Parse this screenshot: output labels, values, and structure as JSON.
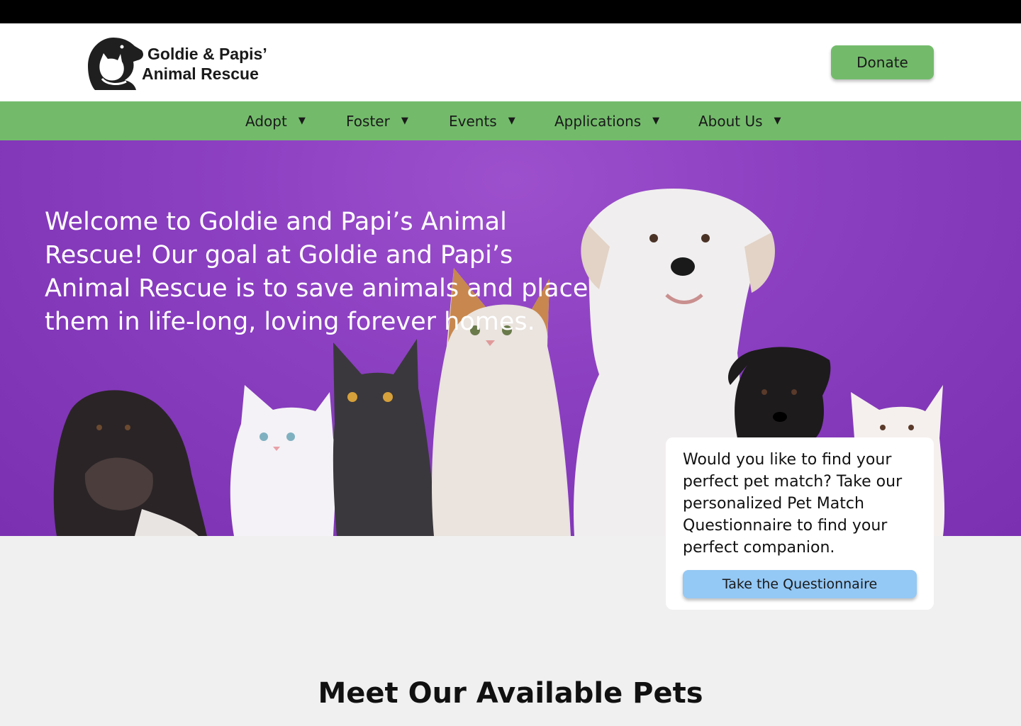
{
  "header": {
    "logo_line1": "Goldie & Papis’",
    "logo_line2": "Animal Rescue",
    "donate_label": "Donate"
  },
  "nav": {
    "items": [
      {
        "label": "Adopt"
      },
      {
        "label": "Foster"
      },
      {
        "label": "Events"
      },
      {
        "label": "Applications"
      },
      {
        "label": "About Us"
      }
    ],
    "caret": "▼"
  },
  "hero": {
    "text": "Welcome to Goldie and Papi’s Animal Rescue! Our goal at Goldie and Papi’s Animal Rescue is to save animals and place them in life-long, loving forever homes."
  },
  "quiz": {
    "text": "Would you like to find your perfect pet match? Take our personalized Pet Match Questionnaire to find your perfect companion.",
    "button_label": "Take the Questionnaire"
  },
  "pets_section": {
    "title": "Meet Our Available Pets"
  },
  "colors": {
    "nav_green": "#73bb6b",
    "hero_purple": "#8a3ec0",
    "quiz_button_blue": "#94c8f5",
    "top_bar": "#000000"
  }
}
